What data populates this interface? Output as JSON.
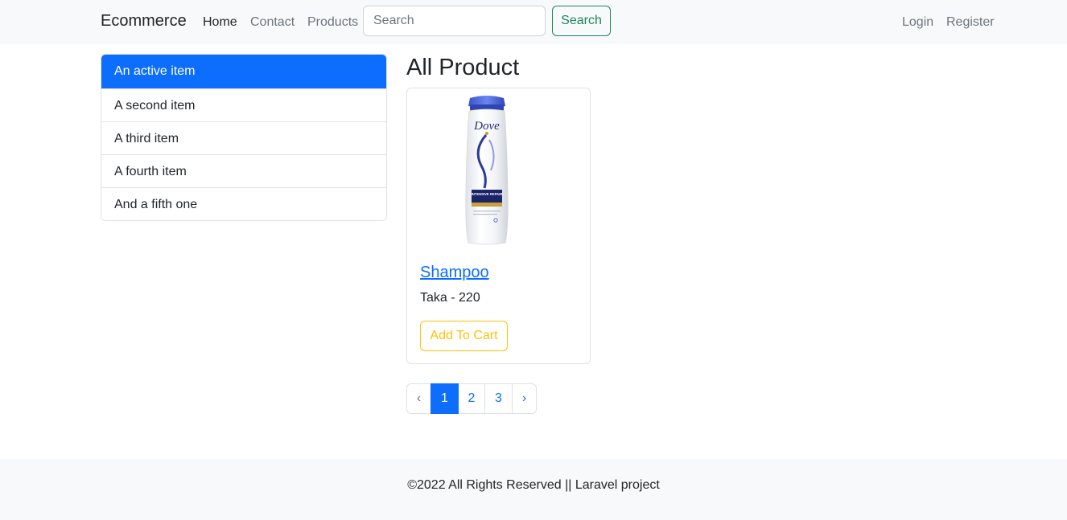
{
  "navbar": {
    "brand": "Ecommerce",
    "links": [
      {
        "label": "Home"
      },
      {
        "label": "Contact"
      },
      {
        "label": "Products"
      }
    ],
    "search": {
      "placeholder": "Search",
      "value": "",
      "button_label": "Search"
    },
    "auth_links": [
      {
        "label": "Login"
      },
      {
        "label": "Register"
      }
    ]
  },
  "sidebar": {
    "items": [
      {
        "label": "An active item",
        "active": true
      },
      {
        "label": "A second item"
      },
      {
        "label": "A third item"
      },
      {
        "label": "A fourth item"
      },
      {
        "label": "And a fifth one"
      }
    ]
  },
  "main": {
    "title": "All Product",
    "products": [
      {
        "name": "Shampoo",
        "price": "Taka - 220",
        "button_label": "Add To Cart",
        "image_brand": "Dove",
        "image_label": "INTENSIVE REPAIR"
      }
    ],
    "pagination": {
      "prev": "‹",
      "pages": [
        "1",
        "2",
        "3"
      ],
      "current": "1",
      "next": "›"
    }
  },
  "footer": {
    "text": "©2022 All Rights Reserved || Laravel project"
  },
  "colors": {
    "primary": "#0d6efd",
    "success": "#198754",
    "warning": "#ffc107",
    "navbar_bg": "#f8f9fa"
  }
}
